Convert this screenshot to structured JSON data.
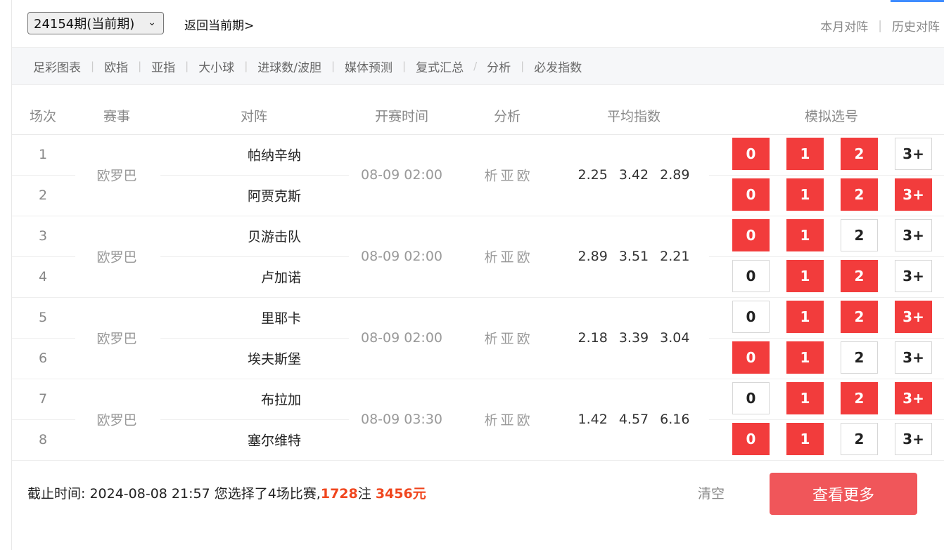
{
  "top": {
    "period_select": "24154期(当前期)",
    "back_link": "返回当前期>",
    "right_links": [
      "本月对阵",
      "历史对阵"
    ]
  },
  "subnav": [
    "足彩图表",
    "欧指",
    "亚指",
    "大小球",
    "进球数/波胆",
    "媒体预测",
    "复式汇总",
    "分析",
    "必发指数"
  ],
  "table": {
    "headers": [
      "场次",
      "赛事",
      "对阵",
      "开赛时间",
      "分析",
      "平均指数",
      "模拟选号"
    ],
    "analysis_labels": [
      "析",
      "亚",
      "欧"
    ],
    "button_labels": [
      "0",
      "1",
      "2",
      "3+"
    ],
    "groups": [
      {
        "league": "欧罗巴",
        "time": "08-09 02:00",
        "odds": [
          "2.25",
          "3.42",
          "2.89"
        ],
        "rows": [
          {
            "no": "1",
            "team": "帕纳辛纳",
            "selected": [
              true,
              true,
              true,
              false
            ]
          },
          {
            "no": "2",
            "team": "阿贾克斯",
            "selected": [
              true,
              true,
              true,
              true
            ]
          }
        ]
      },
      {
        "league": "欧罗巴",
        "time": "08-09 02:00",
        "odds": [
          "2.89",
          "3.51",
          "2.21"
        ],
        "rows": [
          {
            "no": "3",
            "team": "贝游击队",
            "selected": [
              true,
              true,
              false,
              false
            ]
          },
          {
            "no": "4",
            "team": "卢加诺",
            "selected": [
              false,
              true,
              true,
              false
            ]
          }
        ]
      },
      {
        "league": "欧罗巴",
        "time": "08-09 02:00",
        "odds": [
          "2.18",
          "3.39",
          "3.04"
        ],
        "rows": [
          {
            "no": "5",
            "team": "里耶卡",
            "selected": [
              false,
              true,
              true,
              true
            ]
          },
          {
            "no": "6",
            "team": "埃夫斯堡",
            "selected": [
              true,
              true,
              false,
              false
            ]
          }
        ]
      },
      {
        "league": "欧罗巴",
        "time": "08-09 03:30",
        "odds": [
          "1.42",
          "4.57",
          "6.16"
        ],
        "rows": [
          {
            "no": "7",
            "team": "布拉加",
            "selected": [
              false,
              true,
              true,
              true
            ]
          },
          {
            "no": "8",
            "team": "塞尔维特",
            "selected": [
              true,
              true,
              false,
              false
            ]
          }
        ]
      }
    ]
  },
  "footer": {
    "deadline_label": "截止时间:",
    "deadline_value": "2024-08-08 21:57",
    "selected_text": "您选择了4场比赛,",
    "bets_count": "1728",
    "bets_unit": "注",
    "amount": "3456元",
    "clear_label": "清空",
    "more_label": "查看更多"
  },
  "colors": {
    "selected": "#f23c3c",
    "highlight": "#f0461e",
    "more_button": "#f0565a"
  }
}
